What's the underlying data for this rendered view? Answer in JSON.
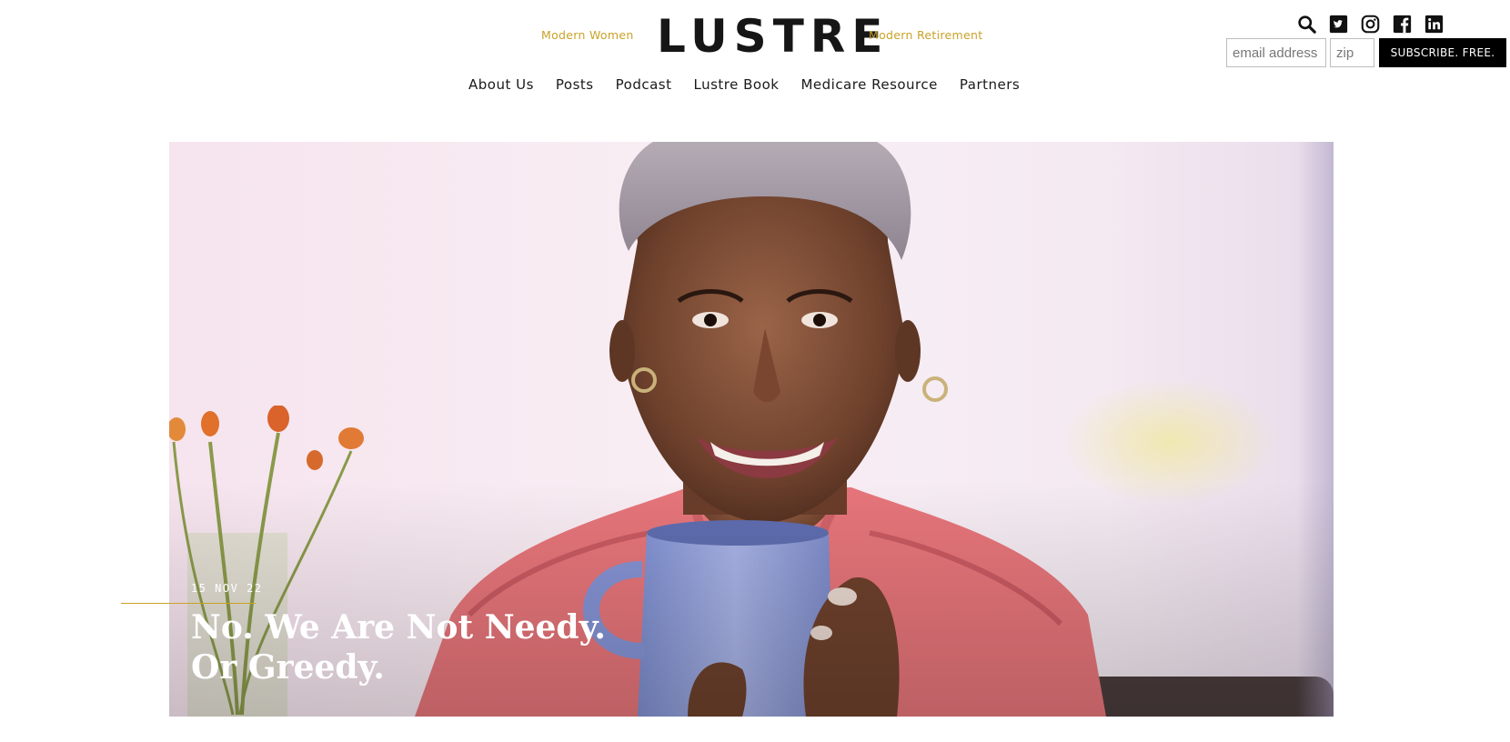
{
  "header": {
    "tagline_left": "Modern Women",
    "logo": "LUSTRE",
    "tagline_right": "Modern Retirement",
    "accent_color": "#c9a227"
  },
  "nav": {
    "items": [
      "About Us",
      "Posts",
      "Podcast",
      "Lustre Book",
      "Medicare Resource",
      "Partners"
    ]
  },
  "icons": [
    "search-icon",
    "twitter-icon",
    "instagram-icon",
    "facebook-icon",
    "linkedin-icon"
  ],
  "subscribe": {
    "email_placeholder": "email address",
    "zip_placeholder": "zip",
    "button_label": "SUBSCRIBE. FREE."
  },
  "featured_post": {
    "date": "15 NOV 22",
    "title": "No. We Are Not Needy. Or Greedy."
  }
}
